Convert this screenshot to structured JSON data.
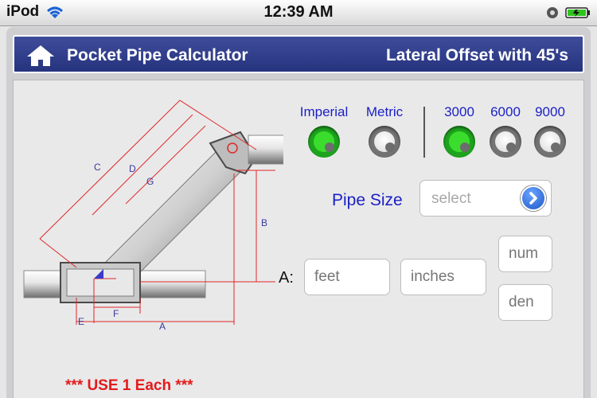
{
  "status_bar": {
    "device": "iPod",
    "time": "12:39 AM"
  },
  "header": {
    "app_title": "Pocket Pipe Calculator",
    "screen_title": "Lateral Offset with 45's"
  },
  "units": {
    "options": [
      {
        "label": "Imperial",
        "selected": true
      },
      {
        "label": "Metric",
        "selected": false
      }
    ]
  },
  "pressure_class": {
    "options": [
      {
        "label": "3000",
        "selected": true
      },
      {
        "label": "6000",
        "selected": false
      },
      {
        "label": "9000",
        "selected": false
      }
    ]
  },
  "pipe_size": {
    "label": "Pipe Size",
    "placeholder": "select"
  },
  "measure_a": {
    "label": "A:",
    "feet_placeholder": "feet",
    "inches_placeholder": "inches",
    "num_placeholder": "num",
    "den_placeholder": "den"
  },
  "diagram": {
    "labels": {
      "c": "C",
      "d": "D",
      "g": "G",
      "b": "B",
      "f": "F",
      "e": "E",
      "a": "A"
    }
  },
  "warning": "*** USE 1 Each  ***",
  "colors": {
    "header_bg": "#2c3a87",
    "label_blue": "#1a1fc4",
    "selected_green": "#3bdd2c",
    "warning_red": "#e31b1b",
    "dimension_red": "#e02828"
  }
}
